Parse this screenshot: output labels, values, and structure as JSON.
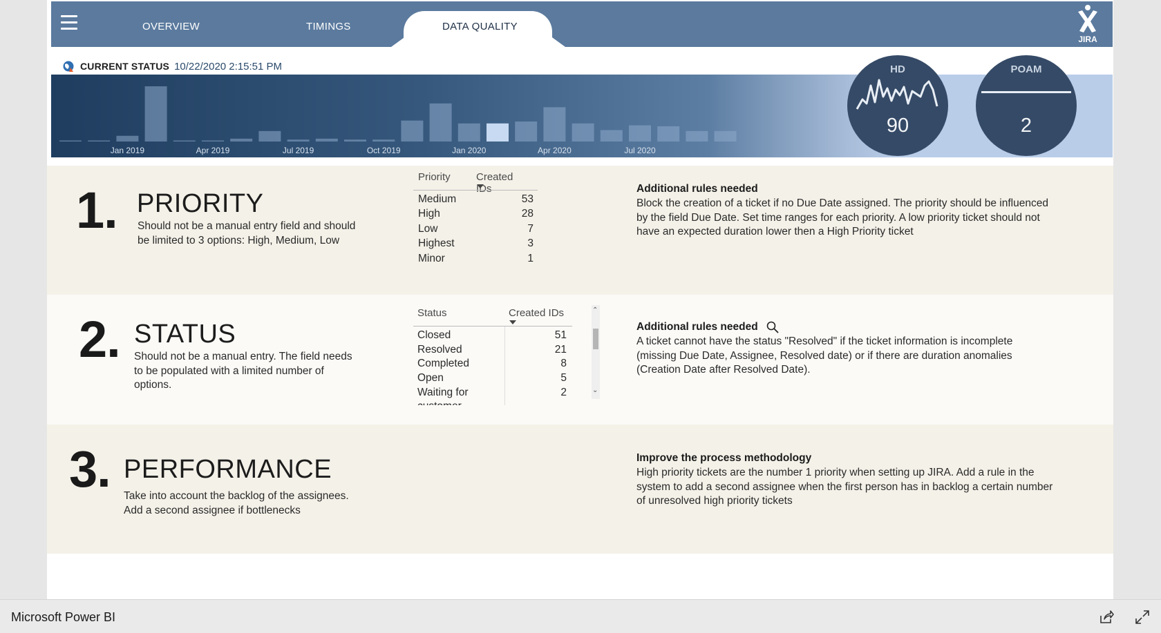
{
  "nav": {
    "tabs": [
      {
        "label": "OVERVIEW"
      },
      {
        "label": "TIMINGS"
      },
      {
        "label": "DATA QUALITY"
      }
    ],
    "active_tab": "DATA QUALITY",
    "logo_text": "JIRA"
  },
  "status": {
    "label": "CURRENT STATUS",
    "timestamp": "10/22/2020 2:15:51 PM"
  },
  "timeline": {
    "x_ticks": [
      "Jan 2019",
      "Apr 2019",
      "Jul 2019",
      "Oct 2019",
      "Jan 2020",
      "Apr 2020",
      "Jul 2020"
    ]
  },
  "chart_data": {
    "type": "bar",
    "categories": [
      "Nov 2018",
      "Dec 2018",
      "Jan 2019",
      "Feb 2019",
      "Mar 2019",
      "Apr 2019",
      "May 2019",
      "Jun 2019",
      "Jul 2019",
      "Aug 2019",
      "Sep 2019",
      "Oct 2019",
      "Nov 2019",
      "Dec 2019",
      "Jan 2020",
      "Feb 2020",
      "Mar 2020",
      "Apr 2020",
      "May 2020",
      "Jun 2020",
      "Jul 2020",
      "Aug 2020",
      "Sep 2020",
      "Oct 2020"
    ],
    "values": [
      1,
      1,
      6,
      58,
      0,
      0,
      3,
      11,
      2,
      3,
      2,
      2,
      22,
      40,
      19,
      19,
      21,
      36,
      19,
      12,
      17,
      16,
      11,
      11
    ],
    "highlight_index": 15,
    "colors": {
      "bar": "#8eaacb",
      "highlight": "#c7daf2"
    }
  },
  "gauges": [
    {
      "title": "HD",
      "value": "90"
    },
    {
      "title": "POAM",
      "value": "2"
    }
  ],
  "sections": [
    {
      "number": "1.",
      "title": "PRIORITY",
      "desc_lines": [
        "Should not be a manual entry field and should",
        "be limited to 3 options: High, Medium, Low"
      ],
      "table": {
        "col1": "Priority",
        "col2": "Created IDs",
        "rows": [
          {
            "name": "Medium",
            "value": "53"
          },
          {
            "name": "High",
            "value": "28"
          },
          {
            "name": "Low",
            "value": "7"
          },
          {
            "name": "Highest",
            "value": "3"
          },
          {
            "name": "Minor",
            "value": "1"
          }
        ]
      },
      "rule_title": "Additional rules needed",
      "rule_lines": [
        "Block the creation of a ticket if no Due Date assigned. The priority should be influenced",
        "by the field Due Date. Set time ranges for each priority. A low priority ticket should not",
        "have an expected duration lower then a High Priority ticket"
      ]
    },
    {
      "number": "2.",
      "title": "STATUS",
      "desc_lines": [
        "Should not be a manual entry. The field needs",
        "to be populated with a limited number of",
        "options."
      ],
      "table": {
        "col1": "Status",
        "col2": "Created IDs",
        "rows": [
          {
            "name": "Closed",
            "value": "51"
          },
          {
            "name": "Resolved",
            "value": "21"
          },
          {
            "name": "Completed",
            "value": "8"
          },
          {
            "name": "Open",
            "value": "5"
          },
          {
            "name": "Waiting for",
            "value": "2"
          }
        ],
        "overflow_text": "customer"
      },
      "rule_title": "Additional rules needed",
      "rule_lines": [
        "A ticket cannot have the status \"Resolved\" if the ticket information is incomplete",
        "(missing Due Date, Assignee, Resolved date) or if there are duration anomalies",
        "(Creation Date after Resolved Date)."
      ]
    },
    {
      "number": "3.",
      "title": "PERFORMANCE",
      "desc_lines": [
        "Take into account the backlog of the assignees.",
        "Add a second assignee if bottlenecks"
      ],
      "rule_title": "Improve the process methodology",
      "rule_lines": [
        "High priority tickets are the number 1 priority when setting up JIRA. Add a rule in the",
        "system to add a second assignee when the first person has in backlog a certain number",
        "of unresolved high priority tickets"
      ]
    }
  ],
  "bottom": {
    "app_name": "Microsoft Power BI"
  }
}
